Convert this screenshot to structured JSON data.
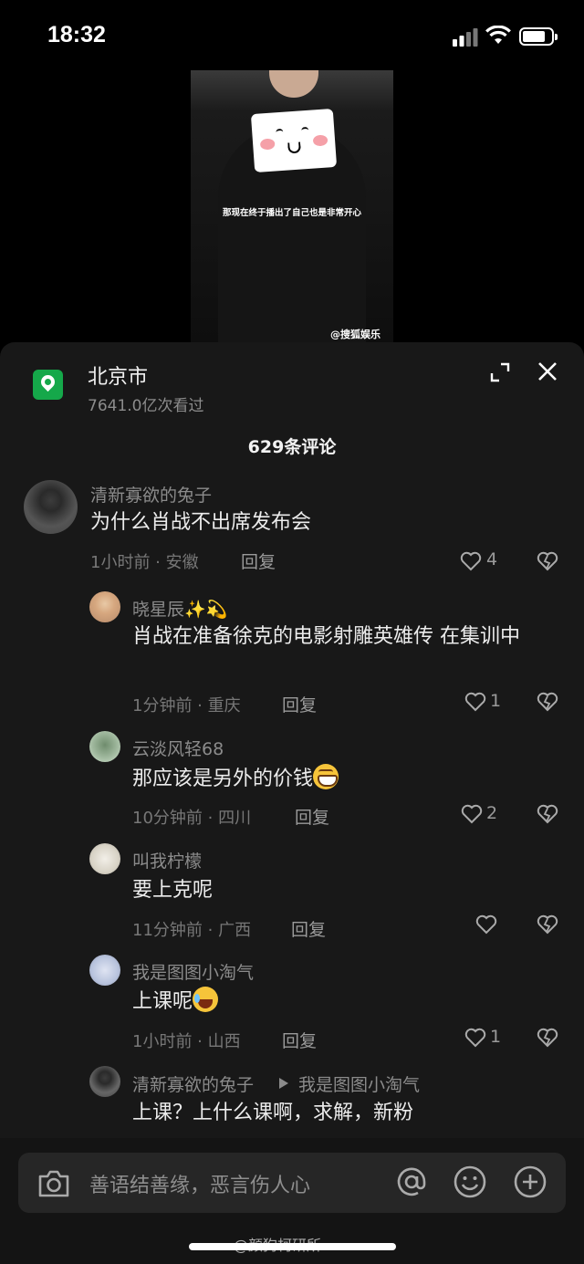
{
  "status_bar": {
    "time": "18:32"
  },
  "video": {
    "subtitle": "那现在终于播出了自己也是非常开心",
    "watermark": "@搜狐娱乐"
  },
  "location": {
    "name": "北京市",
    "views": "7641.0亿次看过",
    "icon_color": "#15a84a"
  },
  "comments_count": "629条评论",
  "comments": [
    {
      "user": "清新寡欲的兔子",
      "text": "为什么肖战不出席发布会",
      "meta": "1小时前 · 安徽",
      "reply": "回复",
      "likes": "4"
    },
    {
      "user": "晓星辰✨💫",
      "text": "肖战在准备徐克的电影射雕英雄传 在集训中",
      "meta": "1分钟前 · 重庆",
      "reply": "回复",
      "likes": "1"
    },
    {
      "user": "云淡风轻68",
      "text": "那应该是另外的价钱",
      "meta": "10分钟前 · 四川",
      "reply": "回复",
      "likes": "2"
    },
    {
      "user": "叫我柠檬",
      "text": "要上克呢",
      "meta": "11分钟前 · 广西",
      "reply": "回复",
      "likes": ""
    },
    {
      "user": "我是图图小淘气",
      "text": "上课呢",
      "meta": "1小时前 · 山西",
      "reply": "回复",
      "likes": "1"
    },
    {
      "user": "清新寡欲的兔子",
      "reply_to": "我是图图小淘气",
      "text": "上课？上什么课啊，求解，新粉"
    }
  ],
  "input": {
    "placeholder": "善语结善缘，恶言伤人心"
  },
  "footer_watermark": "@颜狗柯研所"
}
